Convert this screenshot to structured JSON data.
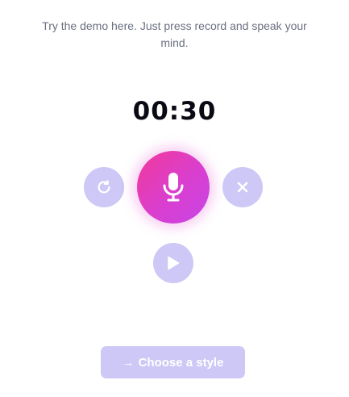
{
  "intro": {
    "text": "Try the demo here. Just press record and speak your mind."
  },
  "timer": {
    "value": "00:30"
  },
  "controls": {
    "reset_icon": "refresh-icon",
    "record_icon": "microphone-icon",
    "clear_icon": "close-icon",
    "play_icon": "play-icon"
  },
  "cta": {
    "arrow": "→",
    "label": "Choose a style"
  },
  "colors": {
    "accent_light": "#cdc8f5",
    "record_gradient_start": "#f2399a",
    "record_gradient_end": "#c844e6",
    "text_muted": "#6b6f80",
    "text_dark": "#0a0a14"
  }
}
